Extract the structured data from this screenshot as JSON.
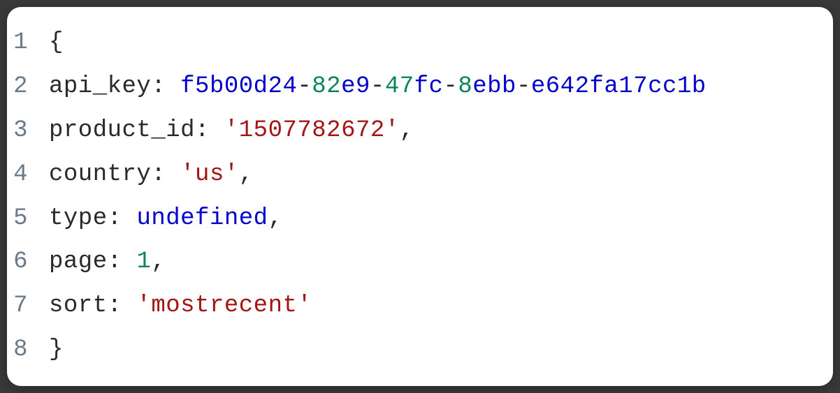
{
  "code": {
    "lines": [
      {
        "number": "1",
        "tokens": [
          {
            "text": "{",
            "class": "tok-punctuation"
          }
        ]
      },
      {
        "number": "2",
        "tokens": [
          {
            "text": "api_key",
            "class": "tok-property"
          },
          {
            "text": ": ",
            "class": "tok-punctuation"
          },
          {
            "text": "f5b00d24",
            "class": "tok-uuid-hex"
          },
          {
            "text": "-",
            "class": "tok-uuid-dash"
          },
          {
            "text": "82",
            "class": "tok-uuid-num"
          },
          {
            "text": "e9",
            "class": "tok-uuid-hex"
          },
          {
            "text": "-",
            "class": "tok-uuid-dash"
          },
          {
            "text": "47",
            "class": "tok-uuid-num"
          },
          {
            "text": "fc",
            "class": "tok-uuid-hex"
          },
          {
            "text": "-",
            "class": "tok-uuid-dash"
          },
          {
            "text": "8",
            "class": "tok-uuid-num"
          },
          {
            "text": "ebb",
            "class": "tok-uuid-hex"
          },
          {
            "text": "-",
            "class": "tok-uuid-dash"
          },
          {
            "text": "e642fa17cc1b",
            "class": "tok-uuid-hex"
          }
        ]
      },
      {
        "number": "3",
        "tokens": [
          {
            "text": "product_id",
            "class": "tok-property"
          },
          {
            "text": ": ",
            "class": "tok-punctuation"
          },
          {
            "text": "'1507782672'",
            "class": "tok-string"
          },
          {
            "text": ",",
            "class": "tok-punctuation"
          }
        ]
      },
      {
        "number": "4",
        "tokens": [
          {
            "text": "country",
            "class": "tok-property"
          },
          {
            "text": ": ",
            "class": "tok-punctuation"
          },
          {
            "text": "'us'",
            "class": "tok-string"
          },
          {
            "text": ",",
            "class": "tok-punctuation"
          }
        ]
      },
      {
        "number": "5",
        "tokens": [
          {
            "text": "type",
            "class": "tok-property"
          },
          {
            "text": ": ",
            "class": "tok-punctuation"
          },
          {
            "text": "undefined",
            "class": "tok-keyword"
          },
          {
            "text": ",",
            "class": "tok-punctuation"
          }
        ]
      },
      {
        "number": "6",
        "tokens": [
          {
            "text": "page",
            "class": "tok-property"
          },
          {
            "text": ": ",
            "class": "tok-punctuation"
          },
          {
            "text": "1",
            "class": "tok-number"
          },
          {
            "text": ",",
            "class": "tok-punctuation"
          }
        ]
      },
      {
        "number": "7",
        "tokens": [
          {
            "text": "sort",
            "class": "tok-property"
          },
          {
            "text": ": ",
            "class": "tok-punctuation"
          },
          {
            "text": "'mostrecent'",
            "class": "tok-string"
          }
        ]
      },
      {
        "number": "8",
        "tokens": [
          {
            "text": "}",
            "class": "tok-punctuation"
          }
        ]
      }
    ]
  }
}
